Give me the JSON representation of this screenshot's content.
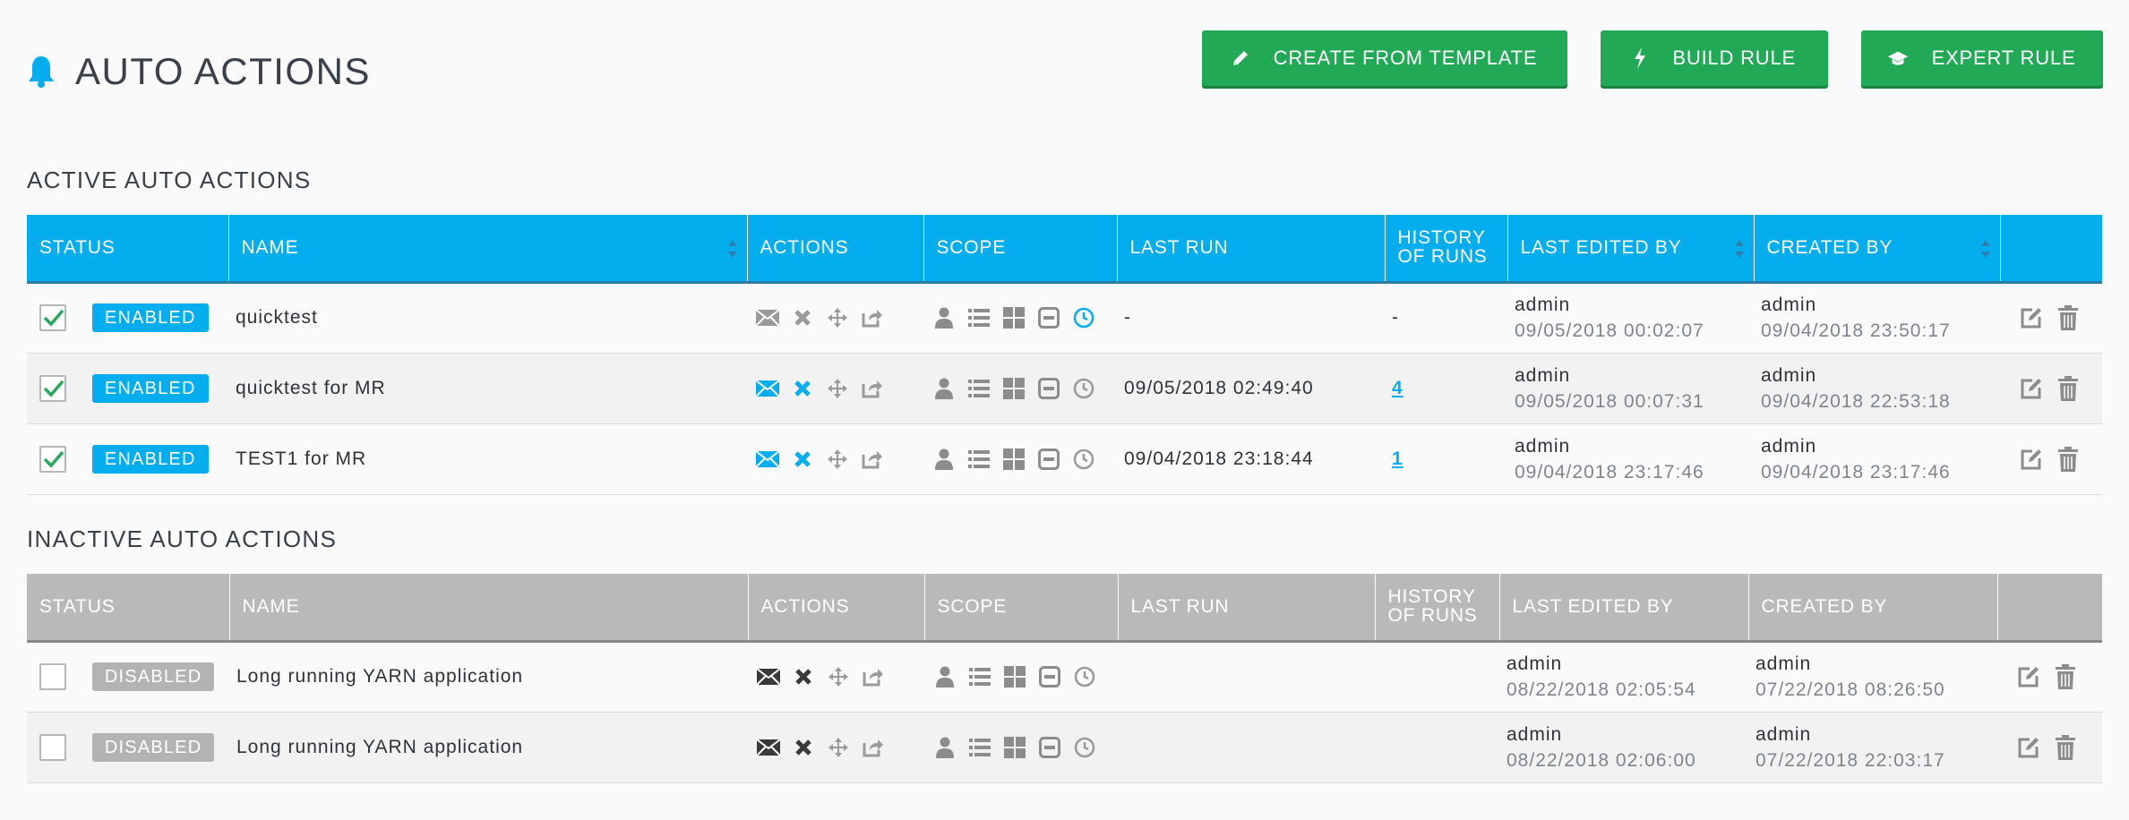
{
  "page": {
    "title": "AUTO ACTIONS"
  },
  "header_buttons": {
    "template_label": "CREATE FROM TEMPLATE",
    "build_label": "BUILD RULE",
    "expert_label": "EXPERT RULE"
  },
  "colors": {
    "accent": "#04aeee",
    "button_green": "#22a955",
    "inactive_header": "#b9b9b9"
  },
  "active": {
    "title": "ACTIVE AUTO ACTIONS",
    "columns": [
      "STATUS",
      "NAME",
      "ACTIONS",
      "SCOPE",
      "LAST RUN",
      "HISTORY",
      "OF RUNS",
      "LAST EDITED BY",
      "CREATED BY"
    ],
    "rows": [
      {
        "status": "ENABLED",
        "name": "quicktest",
        "last_run": "-",
        "history": "-",
        "edited_by": "admin",
        "edited_at": "09/05/2018 00:02:07",
        "created_by": "admin",
        "created_at": "09/04/2018 23:50:17"
      },
      {
        "status": "ENABLED",
        "name": "quicktest for MR",
        "last_run": "09/05/2018 02:49:40",
        "history": "4",
        "edited_by": "admin",
        "edited_at": "09/05/2018 00:07:31",
        "created_by": "admin",
        "created_at": "09/04/2018 22:53:18"
      },
      {
        "status": "ENABLED",
        "name": "TEST1 for MR",
        "last_run": "09/04/2018 23:18:44",
        "history": "1",
        "edited_by": "admin",
        "edited_at": "09/04/2018 23:17:46",
        "created_by": "admin",
        "created_at": "09/04/2018 23:17:46"
      }
    ]
  },
  "inactive": {
    "title": "INACTIVE AUTO ACTIONS",
    "columns": [
      "STATUS",
      "NAME",
      "ACTIONS",
      "SCOPE",
      "LAST RUN",
      "HISTORY",
      "OF RUNS",
      "LAST EDITED BY",
      "CREATED BY"
    ],
    "rows": [
      {
        "status": "DISABLED",
        "name": "Long running YARN application",
        "last_run": "",
        "history": "",
        "edited_by": "admin",
        "edited_at": "08/22/2018 02:05:54",
        "created_by": "admin",
        "created_at": "07/22/2018 08:26:50"
      },
      {
        "status": "DISABLED",
        "name": "Long running YARN application",
        "last_run": "",
        "history": "",
        "edited_by": "admin",
        "edited_at": "08/22/2018 02:06:00",
        "created_by": "admin",
        "created_at": "07/22/2018 22:03:17"
      }
    ]
  }
}
